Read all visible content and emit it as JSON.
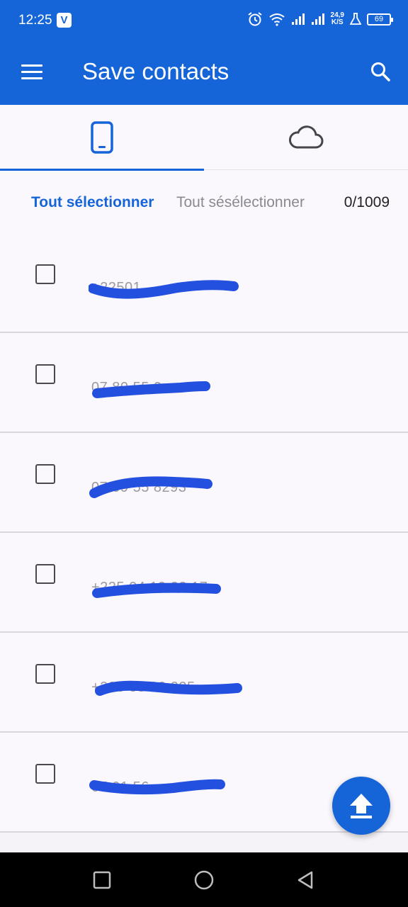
{
  "status_bar": {
    "time": "12:25",
    "app_badge": "V",
    "net_speed_value": "24,9",
    "net_speed_unit": "K/S",
    "battery_level": "69",
    "icons": [
      "alarm-icon",
      "wifi-icon",
      "signal-icon",
      "signal-icon",
      "flask-icon",
      "battery-icon"
    ]
  },
  "app_bar": {
    "title": "Save contacts",
    "menu_icon": "hamburger-menu-icon",
    "search_icon": "search-icon"
  },
  "tabs": [
    {
      "icon": "phone-icon",
      "selected": true
    },
    {
      "icon": "cloud-icon",
      "selected": false
    }
  ],
  "selection": {
    "select_all": "Tout sélectionner",
    "deselect_all": "Tout sésélectionner",
    "count": "0/1009"
  },
  "contacts": [
    {
      "phone": "+22501",
      "checked": false
    },
    {
      "phone": "07 80 55 0",
      "checked": false
    },
    {
      "phone": "07 09 55 8293",
      "checked": false
    },
    {
      "phone": "+225 04 19 22 17",
      "checked": false
    },
    {
      "phone": "+225 85 22 225",
      "checked": false
    },
    {
      "phone": "07 01 56",
      "checked": false
    }
  ],
  "fab": {
    "icon": "upload-icon"
  },
  "nav_bar": {
    "icons": [
      "recents-square-icon",
      "home-circle-icon",
      "back-triangle-icon"
    ]
  },
  "colors": {
    "primary": "#1565d8",
    "scribble": "#2450e0"
  }
}
